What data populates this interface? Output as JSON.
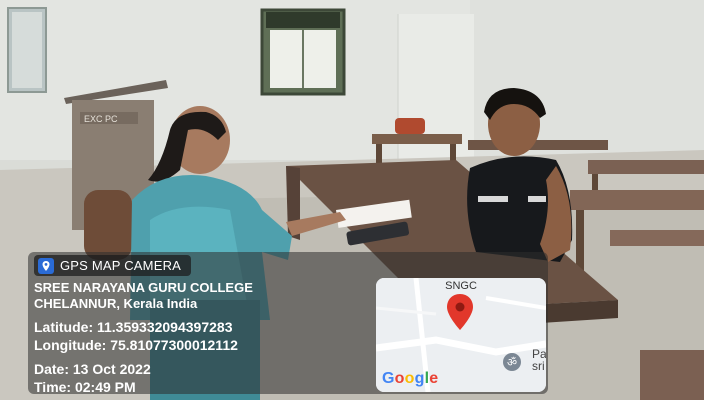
{
  "overlay": {
    "camera_label": "GPS MAP CAMERA",
    "camera_icon": "map-camera-icon",
    "place_line1": "SREE NARAYANA GURU COLLEGE",
    "place_line2": "CHELANNUR, Kerala India",
    "latitude": "Latitude: 11.359332094397283",
    "longitude": "Longitude: 75.81077300012112",
    "date": "Date: 13 Oct 2022",
    "time": "Time: 02:49 PM"
  },
  "map": {
    "place_label": "SNGC",
    "marker_icon": "map-pin-icon",
    "poi_icon": "om-temple-icon",
    "poi_text_line1": "Pa",
    "poi_text_line2": "sri",
    "logo": [
      "G",
      "o",
      "o",
      "g",
      "l",
      "e"
    ],
    "logo_colors": [
      "#4285F4",
      "#EA4335",
      "#FBBC05",
      "#4285F4",
      "#34A853",
      "#EA4335"
    ]
  },
  "scene": {
    "podium_sign": "EXC PC"
  }
}
